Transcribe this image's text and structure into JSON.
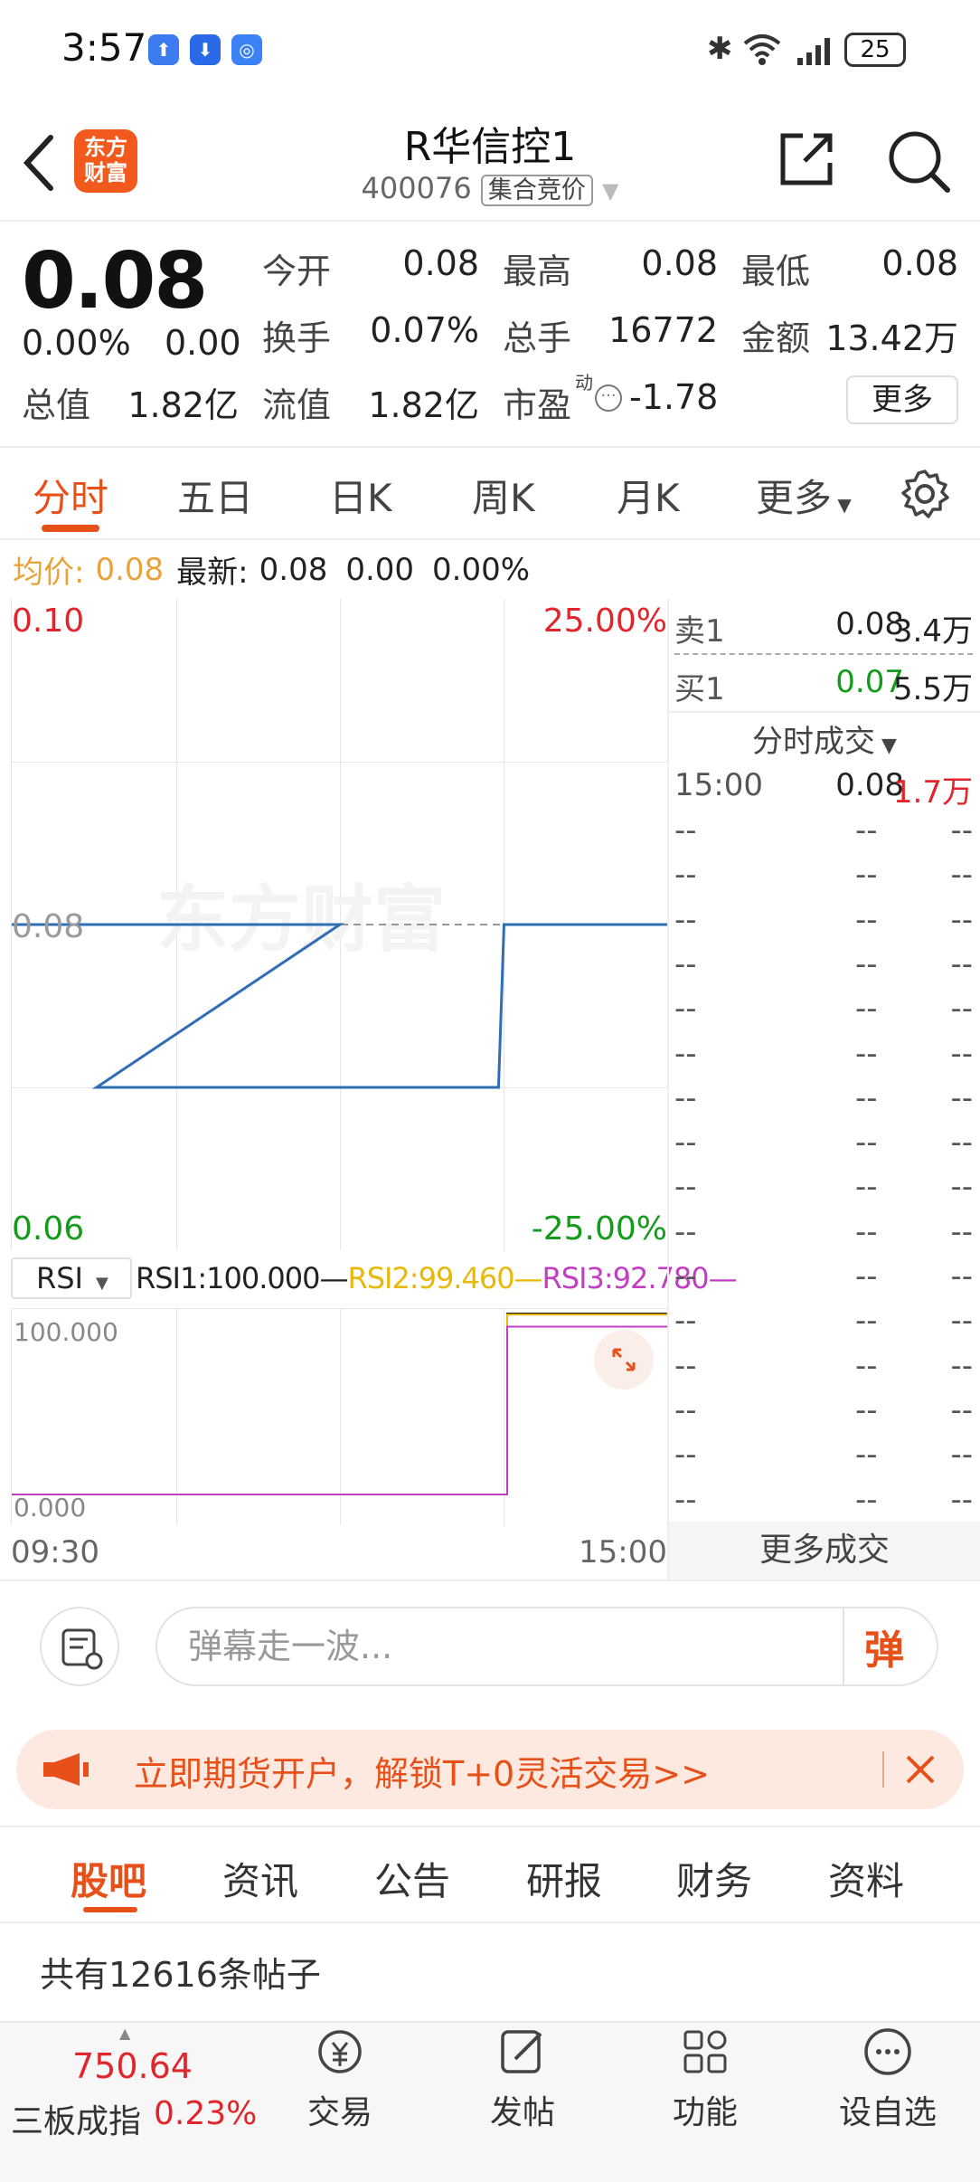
{
  "status": {
    "time": "3:57",
    "battery": "25"
  },
  "header": {
    "logo_text": "东方\n财富",
    "title": "R华信控1",
    "code": "400076",
    "code_tag": "集合竞价"
  },
  "quote": {
    "price": "0.08",
    "change_pct": "0.00%",
    "change": "0.00",
    "fields": [
      {
        "label": "今开",
        "value": "0.08"
      },
      {
        "label": "最高",
        "value": "0.08"
      },
      {
        "label": "最低",
        "value": "0.08"
      },
      {
        "label": "换手",
        "value": "0.07%"
      },
      {
        "label": "总手",
        "value": "16772"
      },
      {
        "label": "金额",
        "value": "13.42万"
      },
      {
        "label": "总值",
        "value": "1.82亿"
      },
      {
        "label": "流值",
        "value": "1.82亿"
      },
      {
        "label": "市盈",
        "value": "-1.78"
      }
    ],
    "pe_sup": "动",
    "more_label": "更多"
  },
  "tabs": [
    "分时",
    "五日",
    "日K",
    "周K",
    "月K",
    "更多"
  ],
  "infoline": {
    "avg_label": "均价:",
    "avg_value": "0.08",
    "latest_label": "最新:",
    "latest_value": "0.08",
    "change": "0.00",
    "change_pct": "0.00%"
  },
  "chart": {
    "y_top": "0.10",
    "y_mid": "0.08",
    "y_bot": "0.06",
    "pct_top": "25.00%",
    "pct_bot": "-25.00%",
    "watermark": "东方财富",
    "indicator": "RSI",
    "rsi1": "RSI1:100.000",
    "rsi2": "RSI2:99.460",
    "rsi3": "RSI3:92.780",
    "rsi_top": "100.000",
    "rsi_bot": "0.000",
    "time_start": "09:30",
    "time_end": "15:00"
  },
  "chart_data": {
    "type": "line",
    "title": "",
    "ylim": [
      0.06,
      0.1
    ],
    "series": [
      {
        "x": [
          "09:30",
          "11:30",
          "11:31",
          "13:58",
          "14:00",
          "15:00"
        ],
        "values": [
          0.08,
          0.08,
          0.07,
          0.07,
          0.08,
          0.08
        ]
      }
    ],
    "rsi": {
      "ylim": [
        0,
        100
      ],
      "series": [
        {
          "name": "RSI1",
          "values": [
            0,
            100
          ]
        },
        {
          "name": "RSI2",
          "values": [
            0,
            99.46
          ]
        },
        {
          "name": "RSI3",
          "values": [
            0,
            92.78
          ]
        }
      ]
    }
  },
  "orderbook": {
    "sell": {
      "label": "卖1",
      "price": "0.08",
      "vol": "3.4万"
    },
    "buy": {
      "label": "买1",
      "price": "0.07",
      "vol": "5.5万"
    },
    "ticks_title": "分时成交",
    "first_tick": {
      "time": "15:00",
      "price": "0.08",
      "vol": "1.7万"
    },
    "empty": "--",
    "more": "更多成交"
  },
  "danmu": {
    "placeholder": "弹幕走一波...",
    "btn": "弹"
  },
  "banner": {
    "text": "立即期货开户，解锁T+0灵活交易>>"
  },
  "bottom_tabs": [
    "股吧",
    "资讯",
    "公告",
    "研报",
    "财务",
    "资料"
  ],
  "post_count": "共有12616条帖子",
  "index": {
    "value": "750.64",
    "name": "三板成指",
    "pct": "0.23%"
  },
  "nav": [
    "交易",
    "发帖",
    "功能",
    "设自选"
  ]
}
